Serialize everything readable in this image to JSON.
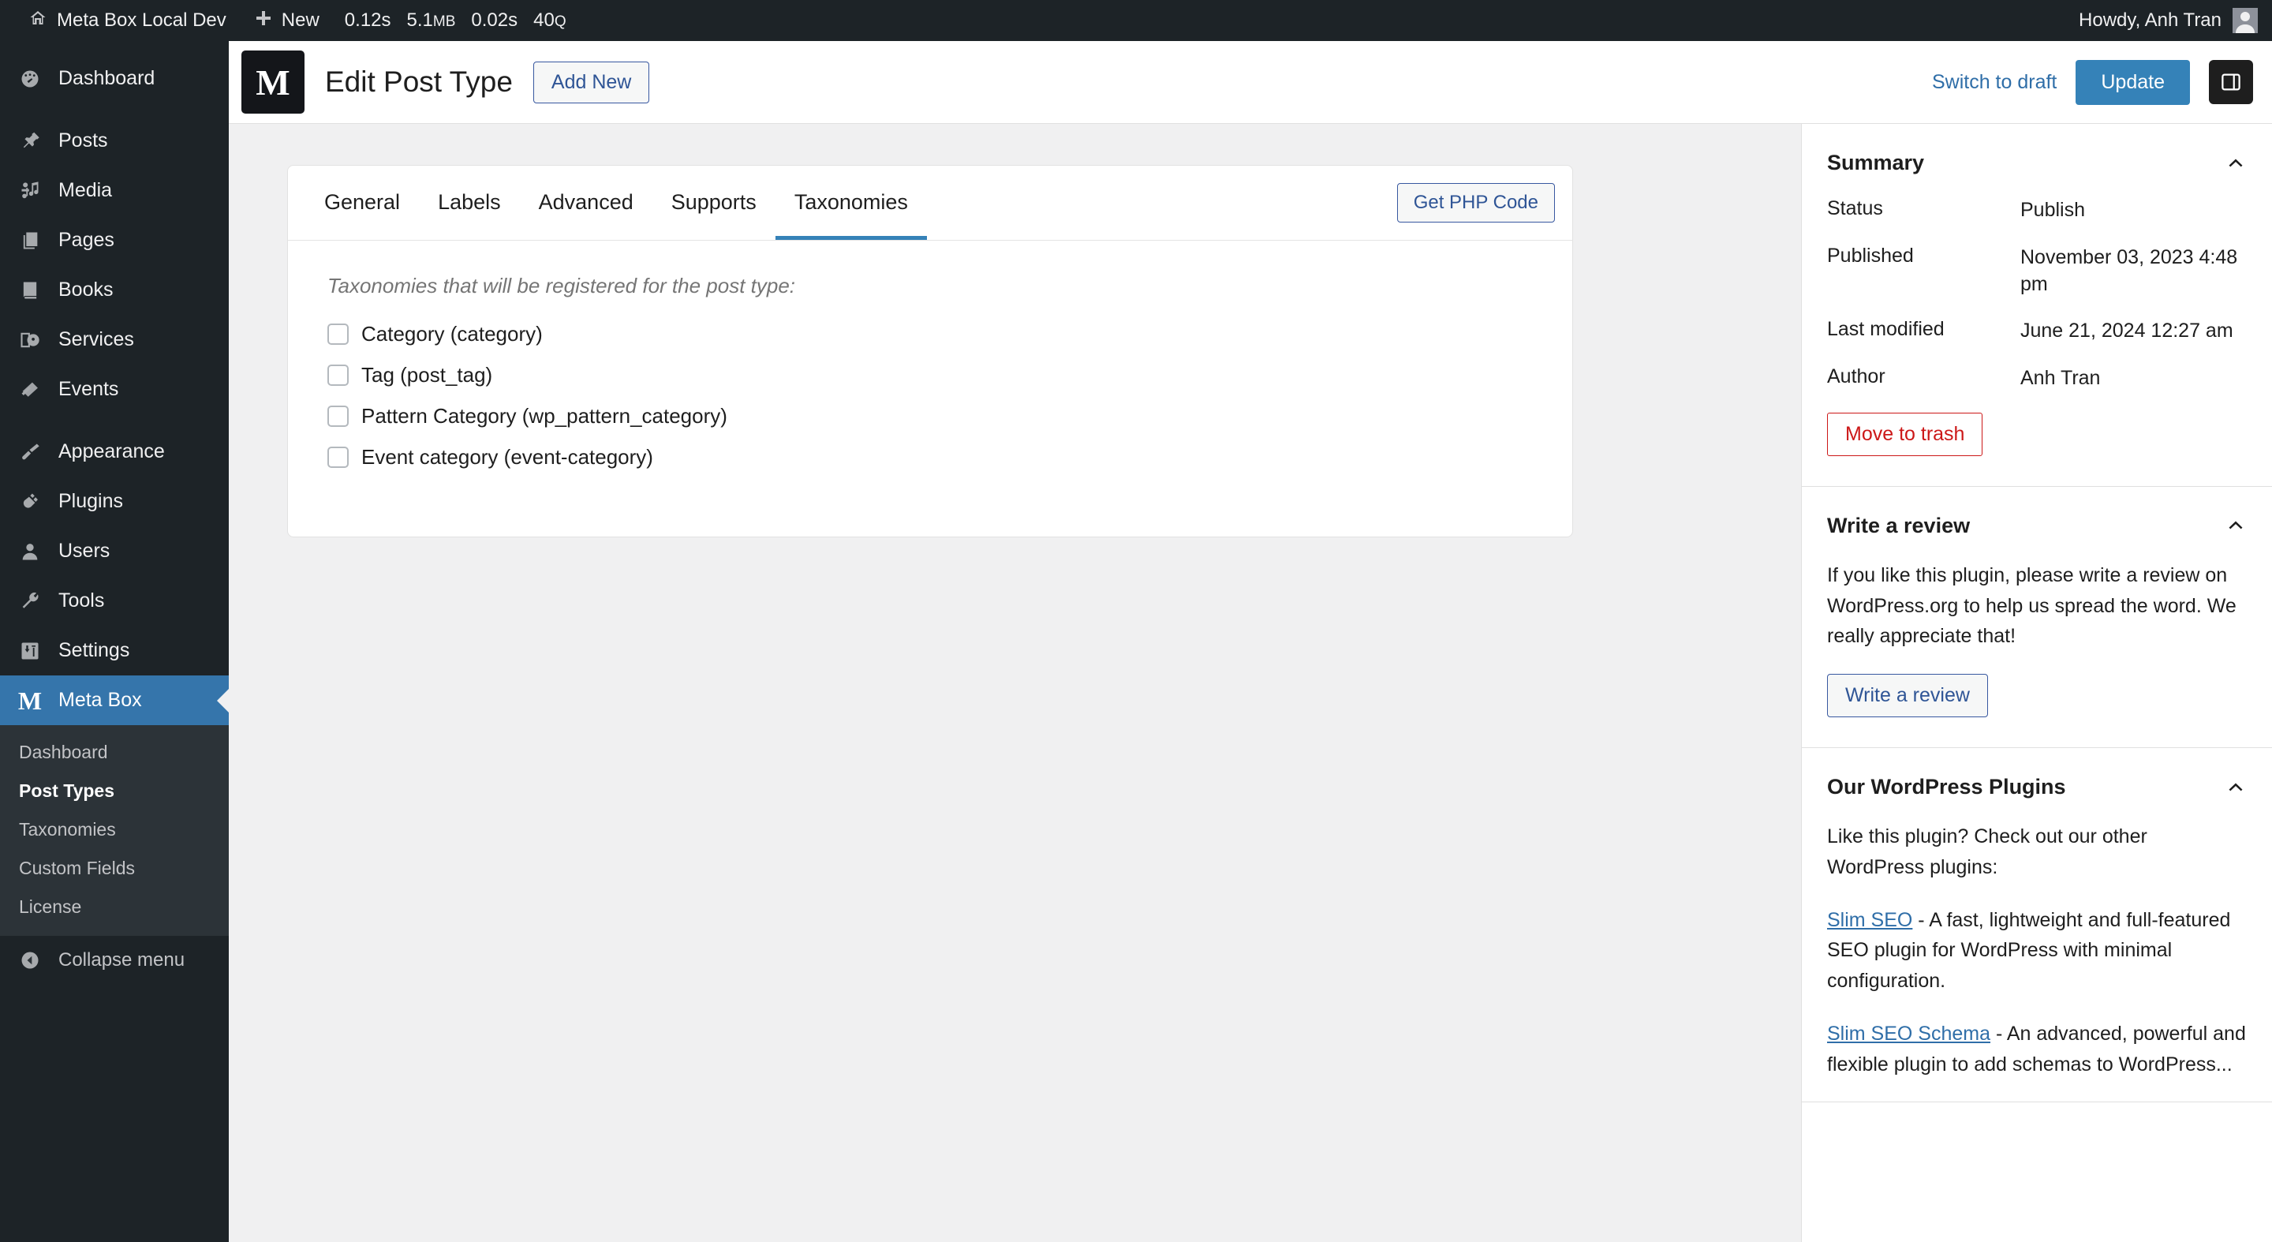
{
  "adminbar": {
    "site_name": "Meta Box Local Dev",
    "new_label": "New",
    "metrics": [
      {
        "value": "0.12s",
        "unit": ""
      },
      {
        "value": "5.1",
        "unit": "MB"
      },
      {
        "value": "0.02s",
        "unit": ""
      },
      {
        "value": "40",
        "unit": "Q"
      }
    ],
    "howdy": "Howdy, Anh Tran"
  },
  "adminmenu": {
    "items": [
      {
        "label": "Dashboard",
        "icon": "dashboard-icon",
        "current": false,
        "sep_after": true
      },
      {
        "label": "Posts",
        "icon": "pin-icon",
        "current": false,
        "sep_after": false
      },
      {
        "label": "Media",
        "icon": "media-icon",
        "current": false,
        "sep_after": false
      },
      {
        "label": "Pages",
        "icon": "pages-icon",
        "current": false,
        "sep_after": false
      },
      {
        "label": "Books",
        "icon": "book-icon",
        "current": false,
        "sep_after": false
      },
      {
        "label": "Services",
        "icon": "services-icon",
        "current": false,
        "sep_after": false
      },
      {
        "label": "Events",
        "icon": "tickets-icon",
        "current": false,
        "sep_after": true
      },
      {
        "label": "Appearance",
        "icon": "brush-icon",
        "current": false,
        "sep_after": false
      },
      {
        "label": "Plugins",
        "icon": "plug-icon",
        "current": false,
        "sep_after": false
      },
      {
        "label": "Users",
        "icon": "user-icon",
        "current": false,
        "sep_after": false
      },
      {
        "label": "Tools",
        "icon": "wrench-icon",
        "current": false,
        "sep_after": false
      },
      {
        "label": "Settings",
        "icon": "sliders-icon",
        "current": false,
        "sep_after": false
      },
      {
        "label": "Meta Box",
        "icon": "metabox-m-icon",
        "current": true,
        "sep_after": false
      }
    ],
    "submenu": [
      {
        "label": "Dashboard",
        "current": false
      },
      {
        "label": "Post Types",
        "current": true
      },
      {
        "label": "Taxonomies",
        "current": false
      },
      {
        "label": "Custom Fields",
        "current": false
      },
      {
        "label": "License",
        "current": false
      }
    ],
    "collapse_label": "Collapse menu",
    "highlight_color": "#3575ab"
  },
  "header": {
    "logo_letter": "M",
    "title": "Edit Post Type",
    "add_new_label": "Add New",
    "switch_to_draft_label": "Switch to draft",
    "update_label": "Update",
    "sidebar_toggle_name": "settings-panel-icon"
  },
  "editor": {
    "tabs": [
      {
        "label": "General",
        "active": false
      },
      {
        "label": "Labels",
        "active": false
      },
      {
        "label": "Advanced",
        "active": false
      },
      {
        "label": "Supports",
        "active": false
      },
      {
        "label": "Taxonomies",
        "active": true
      }
    ],
    "get_php_code_label": "Get PHP Code",
    "hint": "Taxonomies that will be registered for the post type:",
    "taxonomies": [
      {
        "label": "Category (category)",
        "checked": false
      },
      {
        "label": "Tag (post_tag)",
        "checked": false
      },
      {
        "label": "Pattern Category (wp_pattern_category)",
        "checked": false
      },
      {
        "label": "Event category (event-category)",
        "checked": false
      }
    ]
  },
  "sidebar": {
    "summary": {
      "title": "Summary",
      "rows": [
        {
          "key": "Status",
          "value": "Publish"
        },
        {
          "key": "Published",
          "value": "November 03, 2023 4:48 pm"
        },
        {
          "key": "Last modified",
          "value": "June 21, 2024 12:27 am"
        },
        {
          "key": "Author",
          "value": "Anh Tran"
        }
      ],
      "trash_label": "Move to trash"
    },
    "review": {
      "title": "Write a review",
      "text": "If you like this plugin, please write a review on WordPress.org to help us spread the word. We really appreciate that!",
      "button_label": "Write a review"
    },
    "plugins": {
      "title": "Our WordPress Plugins",
      "intro": "Like this plugin? Check out our other WordPress plugins:",
      "items": [
        {
          "link": "Slim SEO",
          "desc": " - A fast, lightweight and full-featured SEO plugin for WordPress with minimal configuration."
        },
        {
          "link": "Slim SEO Schema",
          "desc": " - An advanced, powerful and flexible plugin to add schemas to WordPress..."
        }
      ]
    }
  }
}
